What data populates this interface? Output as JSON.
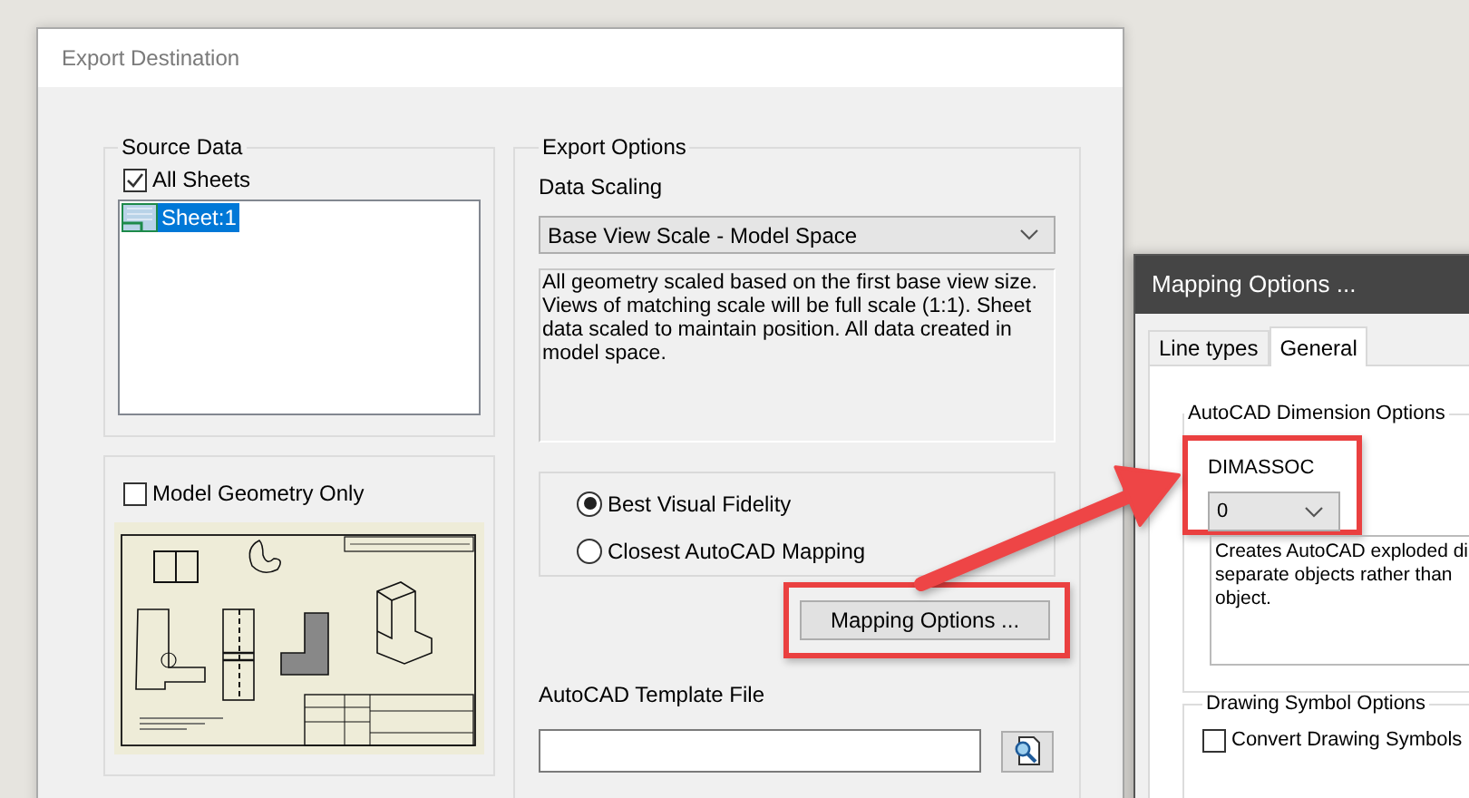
{
  "export_dialog": {
    "title": "Export Destination",
    "source_data": {
      "label": "Source Data",
      "all_sheets": {
        "label": "All Sheets",
        "checked": true
      },
      "sheets": [
        {
          "label": "Sheet:1",
          "selected": true
        }
      ]
    },
    "model_geometry_only": {
      "label": "Model Geometry Only",
      "checked": false
    },
    "export_options": {
      "label": "Export Options",
      "data_scaling": {
        "label": "Data Scaling",
        "value": "Base View Scale - Model Space"
      },
      "description": "All geometry scaled based on the first base view size. Views of matching scale will be full scale (1:1). Sheet data scaled to maintain position. All data created in model space.",
      "fidelity_options": [
        {
          "label": "Best Visual Fidelity",
          "selected": true
        },
        {
          "label": "Closest AutoCAD Mapping",
          "selected": false
        }
      ],
      "mapping_button": {
        "label": "Mapping Options ...",
        "highlighted": true
      },
      "template_file": {
        "label": "AutoCAD Template File"
      }
    }
  },
  "mapping_dialog": {
    "title": "Mapping Options ...",
    "tabs": [
      {
        "label": "Line types",
        "selected": false
      },
      {
        "label": "General",
        "selected": true
      }
    ],
    "dimension_options": {
      "label": "AutoCAD Dimension Options",
      "dimassoc": {
        "label": "DIMASSOC",
        "value": "0",
        "highlighted": true
      },
      "description_lines": [
        "Creates AutoCAD exploded di",
        "separate objects rather than",
        "object."
      ]
    },
    "drawing_symbol_options": {
      "label": "Drawing Symbol Options",
      "convert_drawing_symbols": {
        "label": "Convert Drawing Symbols",
        "checked": false
      }
    }
  },
  "annotation_arrow": true
}
